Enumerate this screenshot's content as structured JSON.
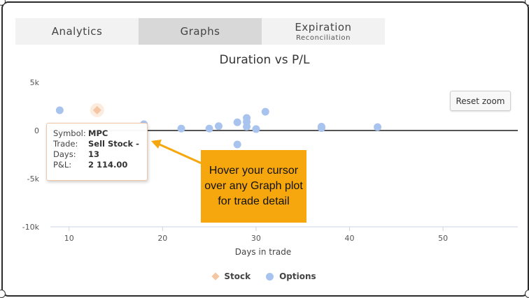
{
  "tabs": [
    {
      "label": "Analytics",
      "sub": ""
    },
    {
      "label": "Graphs",
      "sub": ""
    },
    {
      "label": "Expiration",
      "sub": "Reconciliation"
    }
  ],
  "chart_title": "Duration vs P/L",
  "reset_zoom": "Reset zoom",
  "tooltip": {
    "symbol_key": "Symbol:",
    "symbol_val": "MPC",
    "trade_key": "Trade:",
    "trade_val": "Sell Stock -",
    "days_key": "Days:",
    "days_val": "13",
    "pl_key": "P&L:",
    "pl_val": "2 114.00"
  },
  "callout": "Hover your cursor over any Graph plot for trade detail",
  "legend": {
    "stock": "Stock",
    "options": "Options"
  },
  "colors": {
    "stock": "#f5c6a3",
    "options": "#a9c3ef",
    "callout": "#f5a70d"
  },
  "chart_data": {
    "type": "scatter",
    "title": "Duration vs P/L",
    "xlabel": "Days in trade",
    "ylabel": "",
    "xlim": [
      8,
      58
    ],
    "ylim": [
      -10000,
      5000
    ],
    "xticks": [
      10,
      20,
      30,
      40,
      50
    ],
    "yticks": [
      5000,
      0,
      -5000,
      -10000
    ],
    "ytick_labels": [
      "5k",
      "0",
      "-5k",
      "-10k"
    ],
    "grid": false,
    "legend_position": "bottom",
    "series": [
      {
        "name": "Stock",
        "marker": "diamond",
        "points": [
          {
            "x": 13,
            "y": 2114
          }
        ]
      },
      {
        "name": "Options",
        "marker": "circle",
        "points": [
          {
            "x": 9,
            "y": 2100
          },
          {
            "x": 18,
            "y": 650
          },
          {
            "x": 22,
            "y": 200
          },
          {
            "x": 25,
            "y": 200
          },
          {
            "x": 26,
            "y": 450
          },
          {
            "x": 28,
            "y": 850
          },
          {
            "x": 28,
            "y": -1450
          },
          {
            "x": 29,
            "y": 1300
          },
          {
            "x": 29,
            "y": 900
          },
          {
            "x": 29,
            "y": 400
          },
          {
            "x": 30,
            "y": 150
          },
          {
            "x": 31,
            "y": 1950
          },
          {
            "x": 37,
            "y": 400
          },
          {
            "x": 37,
            "y": 250
          },
          {
            "x": 43,
            "y": 350
          }
        ]
      }
    ]
  }
}
